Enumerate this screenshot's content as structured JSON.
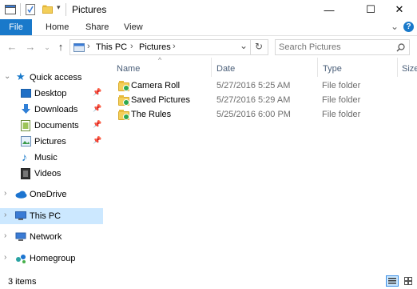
{
  "window": {
    "title": "Pictures",
    "minimize_glyph": "—",
    "maximize_glyph": "☐",
    "close_glyph": "✕"
  },
  "ribbon": {
    "tabs": [
      "File",
      "Home",
      "Share",
      "View"
    ],
    "collapse_glyph": "⌄",
    "help_glyph": "?"
  },
  "address": {
    "segments": [
      "This PC",
      "Pictures"
    ],
    "separator": "›",
    "dropdown_glyph": "⌄",
    "refresh_glyph": "↻"
  },
  "search": {
    "placeholder": "Search Pictures"
  },
  "nav_pane": {
    "quick_access": "Quick access",
    "quick_items": [
      {
        "label": "Desktop",
        "pinned": true
      },
      {
        "label": "Downloads",
        "pinned": true
      },
      {
        "label": "Documents",
        "pinned": true
      },
      {
        "label": "Pictures",
        "pinned": true
      },
      {
        "label": "Music",
        "pinned": false
      },
      {
        "label": "Videos",
        "pinned": false
      }
    ],
    "onedrive": "OneDrive",
    "this_pc": "This PC",
    "network": "Network",
    "homegroup": "Homegroup"
  },
  "columns": {
    "name": "Name",
    "date": "Date",
    "type": "Type",
    "size": "Size"
  },
  "files": [
    {
      "name": "Camera Roll",
      "date": "5/27/2016 5:25 AM",
      "type": "File folder"
    },
    {
      "name": "Saved Pictures",
      "date": "5/27/2016 5:29 AM",
      "type": "File folder"
    },
    {
      "name": "The Rules",
      "date": "5/25/2016 6:00 PM",
      "type": "File folder"
    }
  ],
  "status": {
    "count": "3 items"
  },
  "colors": {
    "accent": "#1979ca",
    "selection": "#cce8ff",
    "header_text": "#4c607a"
  }
}
